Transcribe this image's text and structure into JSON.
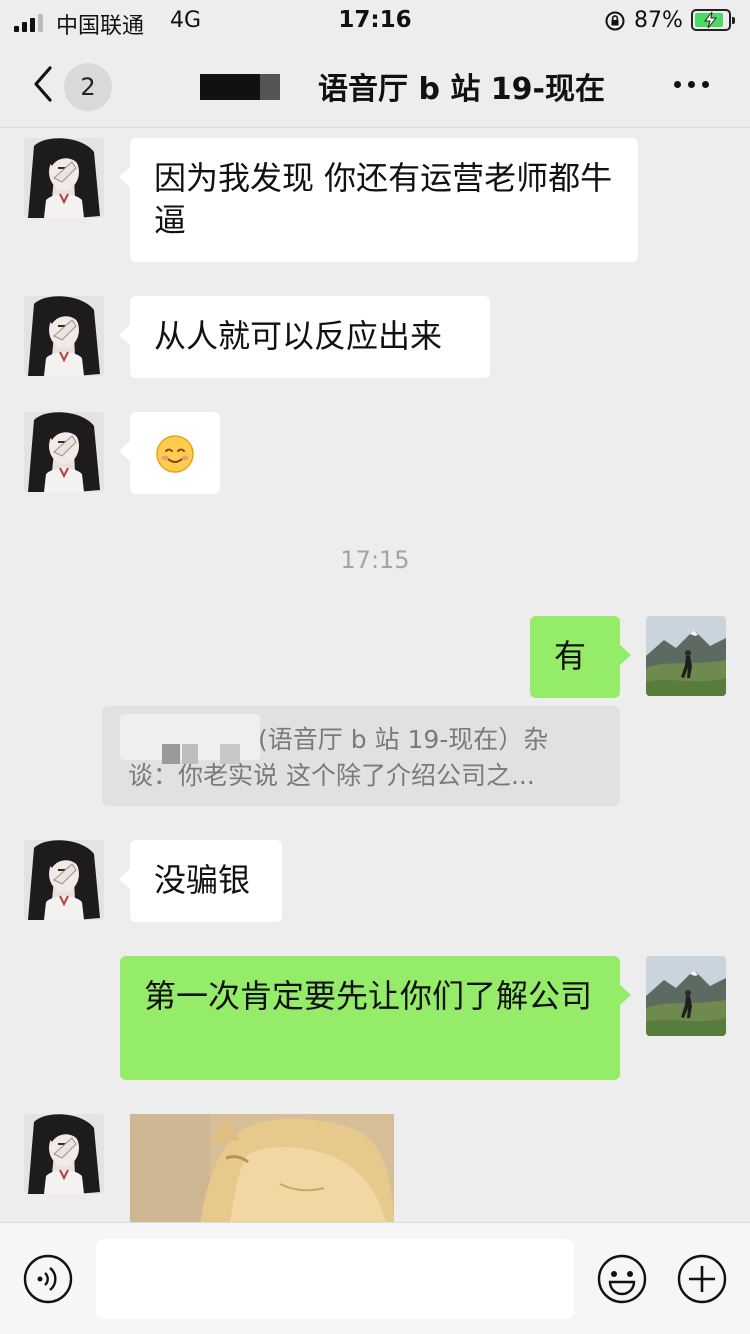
{
  "status_bar": {
    "carrier": "中国联通",
    "network": "4G",
    "time": "17:16",
    "battery_percent": "87%",
    "battery_level": 0.87,
    "battery_color": "#4cd964"
  },
  "nav": {
    "back_icon": "chevron-left-icon",
    "unread_count": "2",
    "title": "语音厅 b 站 19-现在",
    "more_icon": "more-dots-icon"
  },
  "messages": [
    {
      "side": "in",
      "text": "因为我发现 你还有运营老师都牛逼"
    },
    {
      "side": "in",
      "text": "从人就可以反应出来"
    },
    {
      "side": "in",
      "emoji": "smiling-face-emoji"
    },
    {
      "side": "out",
      "text": "有"
    },
    {
      "side": "in",
      "text": "没骗银"
    },
    {
      "side": "out",
      "text": "第一次肯定要先让你们了解公司"
    },
    {
      "side": "in",
      "image": "cat-photo"
    }
  ],
  "time_divider": "17:15",
  "quote": {
    "line1": "(语音厅 b 站 19-现在）杂",
    "line2": "谈：你老实说 这个除了介绍公司之..."
  },
  "input_bar": {
    "voice_icon": "voice-icon",
    "emoji_icon": "emoji-icon",
    "plus_icon": "plus-icon",
    "accent": "#95ec69"
  }
}
